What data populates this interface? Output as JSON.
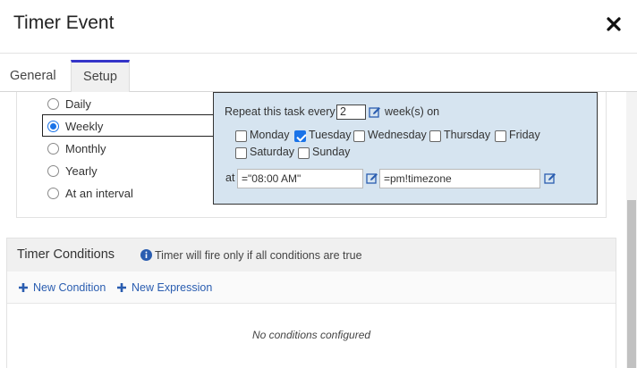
{
  "header": {
    "title": "Timer Event"
  },
  "tabs": [
    {
      "label": "General"
    },
    {
      "label": "Setup"
    }
  ],
  "schedule": {
    "options": [
      {
        "label": "Daily",
        "selected": false
      },
      {
        "label": "Weekly",
        "selected": true
      },
      {
        "label": "Monthly",
        "selected": false
      },
      {
        "label": "Yearly",
        "selected": false
      },
      {
        "label": "At an interval",
        "selected": false
      }
    ]
  },
  "weekly": {
    "repeat_prefix": "Repeat this task every",
    "repeat_value": "2",
    "repeat_suffix": "week(s) on",
    "days": [
      {
        "label": "Monday",
        "checked": false
      },
      {
        "label": "Tuesday",
        "checked": true
      },
      {
        "label": "Wednesday",
        "checked": false
      },
      {
        "label": "Thursday",
        "checked": false
      },
      {
        "label": "Friday",
        "checked": false
      },
      {
        "label": "Saturday",
        "checked": false
      },
      {
        "label": "Sunday",
        "checked": false
      }
    ],
    "at_label": "at",
    "time_value": "=\"08:00 AM\"",
    "timezone_value": "=pm!timezone"
  },
  "conditions": {
    "title": "Timer Conditions",
    "info": "Timer will fire only if all conditions are true",
    "new_condition": "New Condition",
    "new_expression": "New Expression",
    "empty": "No conditions configured"
  },
  "colors": {
    "accent": "#3434c8",
    "link": "#2a5db0",
    "panel": "#d6e4f0",
    "check": "#1a73e8"
  }
}
